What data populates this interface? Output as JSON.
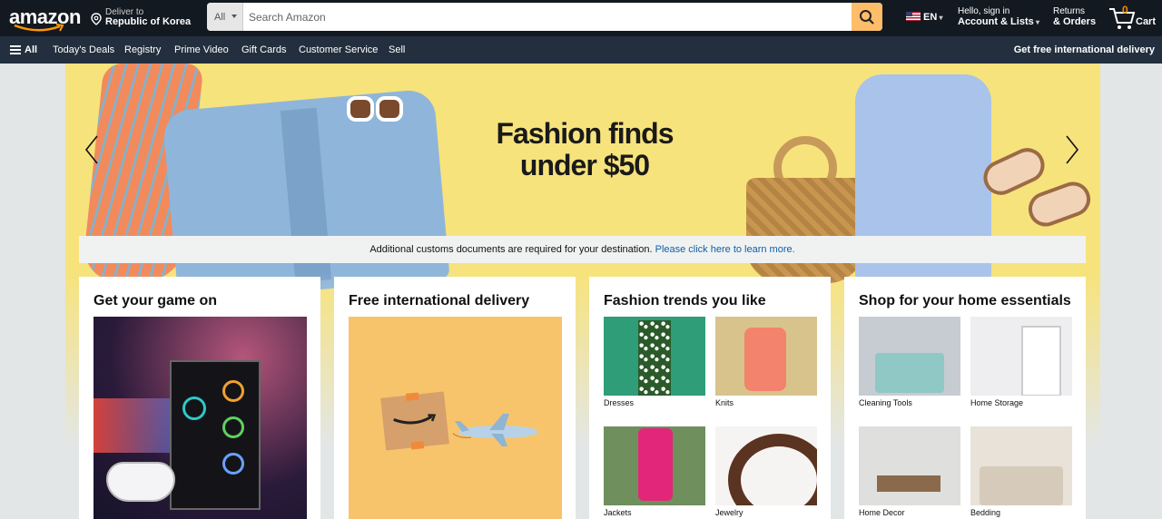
{
  "header": {
    "logo": "amazon",
    "deliver_line1": "Deliver to",
    "deliver_line2": "Republic of Korea",
    "search_category": "All",
    "search_placeholder": "Search Amazon",
    "language": "EN",
    "account_line1": "Hello, sign in",
    "account_line2": "Account & Lists",
    "orders_line1": "Returns",
    "orders_line2": "& Orders",
    "cart_count": "0",
    "cart_label": "Cart"
  },
  "nav": {
    "all_label": "All",
    "items": [
      "Today's Deals",
      "Registry",
      "Prime Video",
      "Gift Cards",
      "Customer Service",
      "Sell"
    ],
    "promo": "Get free international delivery"
  },
  "hero": {
    "title_line1": "Fashion finds",
    "title_line2": "under $50"
  },
  "customs": {
    "text": "Additional customs documents are required for your destination.",
    "link": "Please click here to learn more."
  },
  "cards": [
    {
      "title": "Get your game on"
    },
    {
      "title": "Free international delivery"
    },
    {
      "title": "Fashion trends you like",
      "tiles": [
        "Dresses",
        "Knits",
        "Jackets",
        "Jewelry"
      ]
    },
    {
      "title": "Shop for your home essentials",
      "tiles": [
        "Cleaning Tools",
        "Home Storage",
        "Home Decor",
        "Bedding"
      ]
    }
  ],
  "colors": {
    "topbar": "#131921",
    "navbar": "#232f3e",
    "search_button": "#febd69",
    "hero_bg": "#f7e37c",
    "link": "#0f5fa8",
    "cart_count": "#f08804"
  },
  "icons": [
    "location-pin-icon",
    "search-icon",
    "us-flag-icon",
    "cart-icon",
    "hamburger-icon",
    "chevron-left-icon",
    "chevron-right-icon"
  ]
}
